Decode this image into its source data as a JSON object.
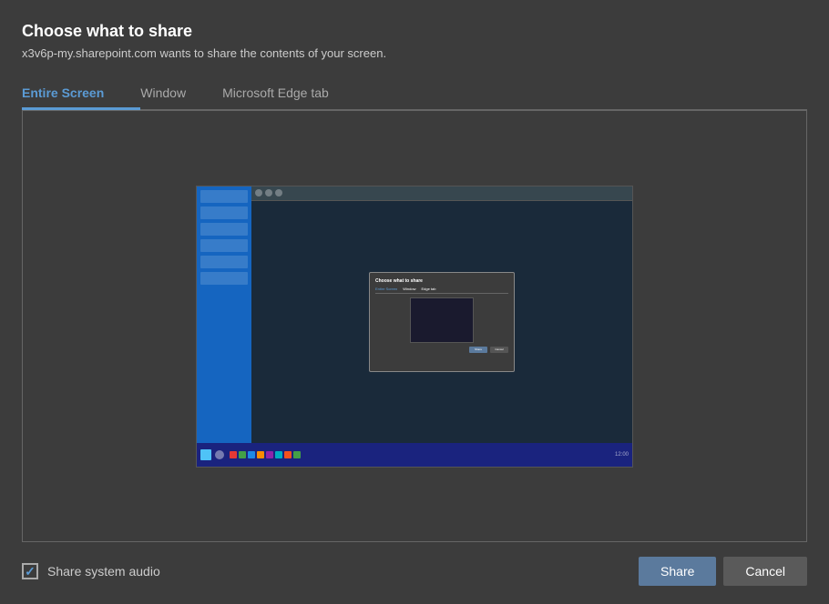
{
  "dialog": {
    "title": "Choose what to share",
    "subtitle": "x3v6p-my.sharepoint.com wants to share the contents of your screen."
  },
  "tabs": [
    {
      "id": "entire-screen",
      "label": "Entire Screen",
      "active": true
    },
    {
      "id": "window",
      "label": "Window",
      "active": false
    },
    {
      "id": "edge-tab",
      "label": "Microsoft Edge tab",
      "active": false
    }
  ],
  "footer": {
    "checkbox_label": "Share system audio",
    "checkbox_checked": true,
    "share_button": "Share",
    "cancel_button": "Cancel"
  },
  "colors": {
    "active_tab": "#5b9bd5",
    "share_btn_bg": "#5b7a9d",
    "cancel_btn_bg": "#5a5a5a"
  }
}
